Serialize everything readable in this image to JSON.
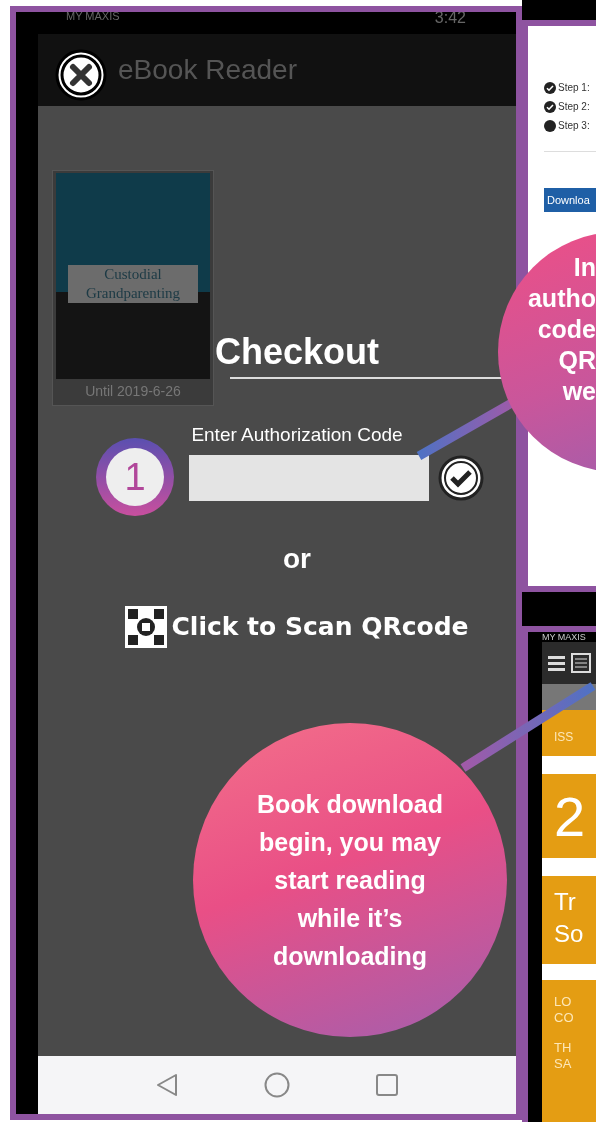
{
  "reader": {
    "status_bar": {
      "carrier": "MY MAXIS",
      "time": "3:42"
    },
    "title": "eBook Reader",
    "book": {
      "cover_title": "Custodial Grandparenting",
      "due": "Until 2019-6-26"
    },
    "checkout": {
      "title": "Checkout",
      "code_label": "Enter Authorization Code",
      "or": "or",
      "scan": "Click to Scan QRcode"
    }
  },
  "step_badge": "1",
  "web_panel": {
    "steps": [
      {
        "label": "Step 1:",
        "done": true
      },
      {
        "label": "Step 2:",
        "done": true
      },
      {
        "label": "Step 3:",
        "done": false
      }
    ],
    "button": "Downloa"
  },
  "callouts": [
    {
      "kind": "partial",
      "lines": [
        "In",
        "autho",
        "code",
        "QR",
        "we"
      ]
    },
    {
      "kind": "full",
      "lines": [
        "Book download",
        "begin, you may",
        "start reading",
        "while it’s",
        "downloading"
      ]
    }
  ],
  "app_panel": {
    "carrier": "MY MAXIS",
    "label": "ISS",
    "number": "2",
    "title_lines": [
      "Tr",
      "So"
    ],
    "lines": [
      "LO",
      "CO",
      "TH",
      "SA"
    ]
  }
}
